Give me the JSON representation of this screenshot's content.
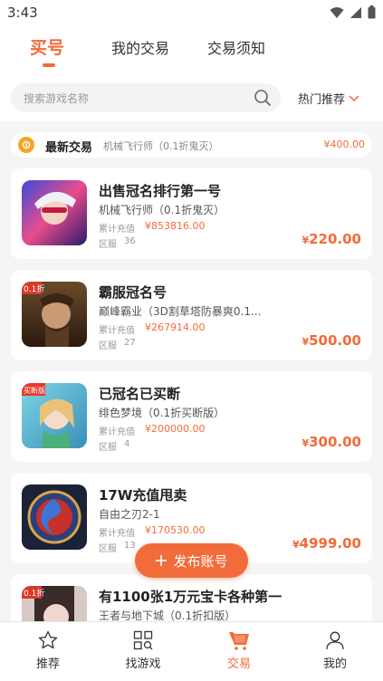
{
  "status_bar": {
    "time": "3:43"
  },
  "top_tabs": [
    {
      "label": "买号",
      "active": true
    },
    {
      "label": "我的交易",
      "active": false
    },
    {
      "label": "交易须知",
      "active": false
    }
  ],
  "search": {
    "placeholder": "搜索游戏名称",
    "sort_label": "热门推荐"
  },
  "ticker": {
    "title": "最新交易",
    "desc": "机械飞行师（0.1折鬼灭）",
    "price": "¥400.00"
  },
  "labels": {
    "recharge": "累计充值",
    "server": "区服"
  },
  "listings": [
    {
      "title": "出售冠名排行第一号",
      "game": "机械飞行师（0.1折鬼灭）",
      "recharge": "¥853816.00",
      "server": "36",
      "price_symbol": "¥",
      "price": "220.00"
    },
    {
      "title": "霸服冠名号",
      "game": "巅峰霸业（3D割草塔防暴爽0.1...",
      "recharge": "¥267914.00",
      "server": "27",
      "price_symbol": "¥",
      "price": "500.00"
    },
    {
      "title": "已冠名已买断",
      "game": "绯色梦境（0.1折买断版）",
      "recharge": "¥200000.00",
      "server": "4",
      "price_symbol": "¥",
      "price": "300.00"
    },
    {
      "title": "17W充值甩卖",
      "game": "自由之刃2-1",
      "recharge": "¥170530.00",
      "server": "13",
      "price_symbol": "¥",
      "price": "4999.00"
    },
    {
      "title": "有1100张1万元宝卡各种第一",
      "game": "王者与地下城（0.1折扣版）"
    }
  ],
  "badges": {
    "listing_1": "0.1折",
    "listing_2": "买断版",
    "listing_4": "0.1折"
  },
  "fab": {
    "label": "发布账号"
  },
  "bottom_nav": [
    {
      "label": "推荐",
      "icon": "star-icon",
      "active": false
    },
    {
      "label": "找游戏",
      "icon": "grid-search-icon",
      "active": false
    },
    {
      "label": "交易",
      "icon": "cart-icon",
      "active": true
    },
    {
      "label": "我的",
      "icon": "person-icon",
      "active": false
    }
  ],
  "colors": {
    "accent": "#f26b3a",
    "background": "#f5f5f5"
  }
}
